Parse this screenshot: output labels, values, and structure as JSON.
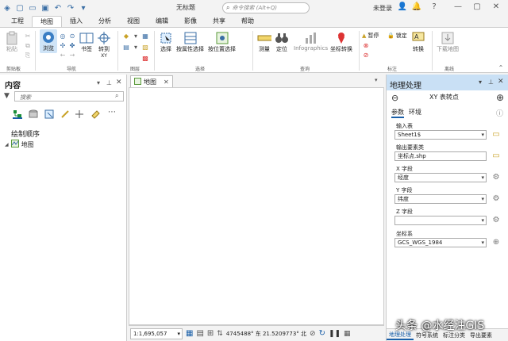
{
  "window": {
    "title": "无标题",
    "search_placeholder": "命令搜索 (Alt+Q)",
    "user": "未登录"
  },
  "ribbon_tabs": [
    "工程",
    "地图",
    "插入",
    "分析",
    "视图",
    "编辑",
    "影像",
    "共享",
    "帮助"
  ],
  "ribbon": {
    "clipboard": {
      "paste": "粘贴",
      "group": "剪贴板"
    },
    "navigate": {
      "explore": "浏览",
      "bookmarks": "书签",
      "goto_xy_line1": "转到",
      "goto_xy_line2": "XY",
      "group": "导航"
    },
    "layer": {
      "group": "图层"
    },
    "selection": {
      "select": "选择",
      "by_attr": "按属性选择",
      "by_loc": "按位置选择",
      "group": "选择"
    },
    "inquiry": {
      "measure": "测量",
      "locate": "定位",
      "infographics": "Infographics",
      "coord_convert": "坐标转换",
      "group": "查询"
    },
    "labeling": {
      "pause": "暂停",
      "lock": "锁定",
      "convert": "转换",
      "group": "标注"
    },
    "offline": {
      "download_map": "下载地图",
      "group": "离线"
    }
  },
  "contents": {
    "title": "内容",
    "search_placeholder": "搜索",
    "draw_order": "绘制顺序",
    "map_item": "地图"
  },
  "map_view": {
    "tab_label": "地图",
    "scale": "1:1,695,057",
    "coords": "4745488° 东  21.5209773° 北"
  },
  "geoprocessing": {
    "title": "地理处理",
    "tool_title": "XY 表转点",
    "tab_params": "参数",
    "tab_env": "环境",
    "input_table_label": "输入表",
    "input_table_value": "Sheet1$",
    "output_label": "输出要素类",
    "output_value": "坐标点.shp",
    "x_label": "X 字段",
    "x_value": "经度",
    "y_label": "Y 字段",
    "y_value": "纬度",
    "z_label": "Z 字段",
    "z_value": "",
    "crs_label": "坐标系",
    "crs_value": "GCS_WGS_1984",
    "bottom_tabs": [
      "地理处理",
      "符号系统",
      "标注分类",
      "导出要素"
    ]
  },
  "watermark": "头条 @水经注GIS",
  "colors": {
    "accent": "#1a5fa8",
    "pane_header": "#c9e0f5"
  }
}
